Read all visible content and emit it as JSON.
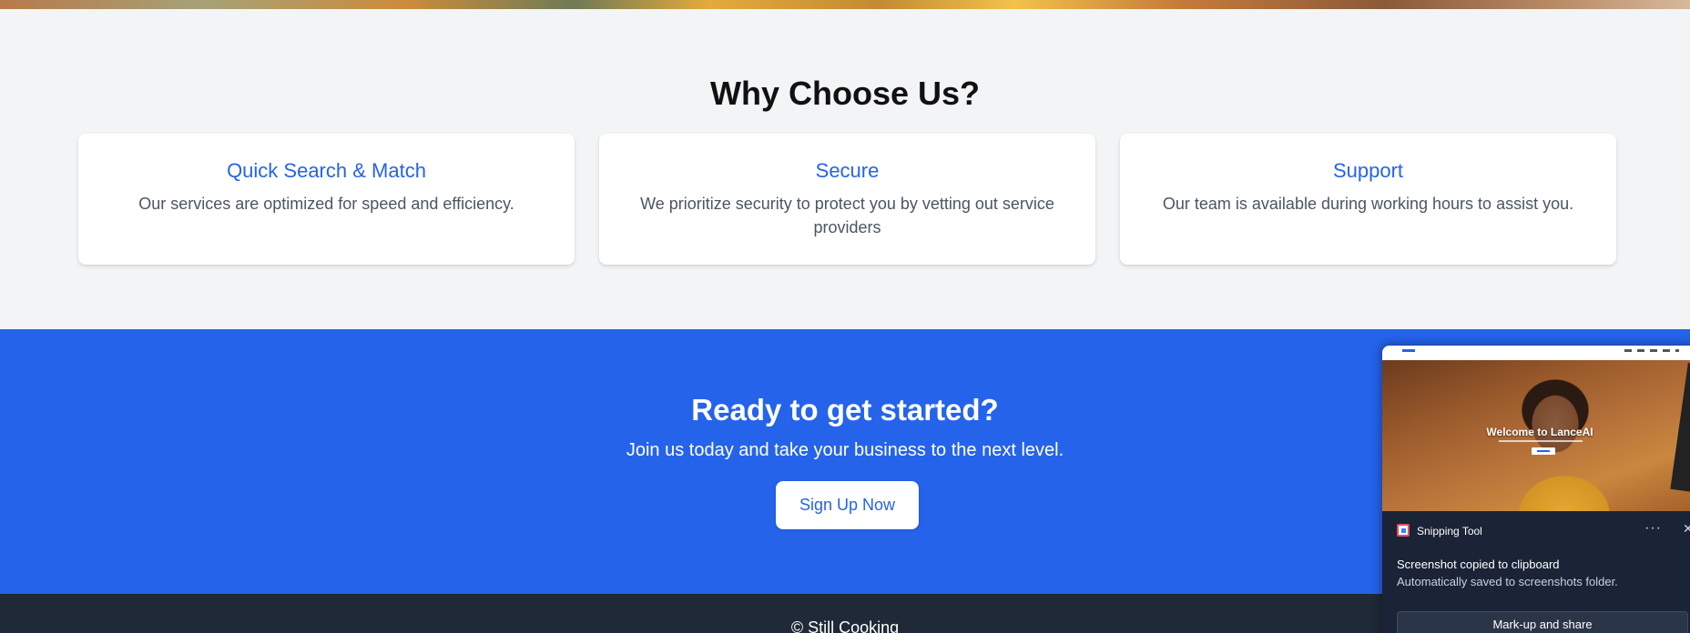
{
  "features": {
    "title": "Why Choose Us?",
    "cards": [
      {
        "title": "Quick Search & Match",
        "description": "Our services are optimized for speed and efficiency."
      },
      {
        "title": "Secure",
        "description": "We prioritize security to protect you by vetting out service providers"
      },
      {
        "title": "Support",
        "description": "Our team is available during working hours to assist you."
      }
    ]
  },
  "cta": {
    "title": "Ready to get started?",
    "subtitle": "Join us today and take your business to the next level.",
    "button_label": "Sign Up Now"
  },
  "footer": {
    "text": "© Still Cooking"
  },
  "toast": {
    "app_name": "Snipping Tool",
    "title": "Screenshot copied to clipboard",
    "subtitle": "Automatically saved to screenshots folder.",
    "action_label": "Mark-up and share",
    "preview_heading": "Welcome to LanceAI"
  },
  "colors": {
    "primary": "#2563eb",
    "section_background": "#f3f4f6",
    "footer_background": "#1f2937",
    "toast_background": "#1b2436"
  },
  "icons": [
    "snipping-tool-icon",
    "more-icon",
    "close-icon"
  ]
}
